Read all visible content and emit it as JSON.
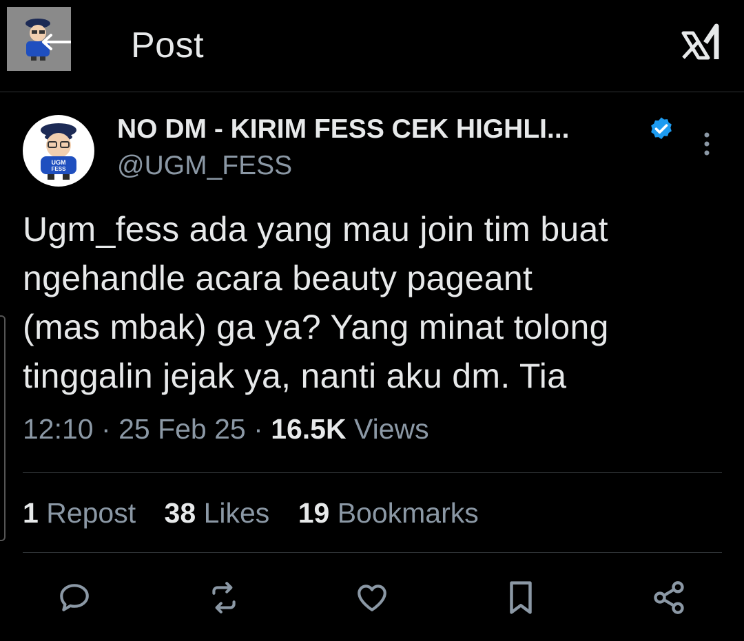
{
  "header": {
    "title": "Post",
    "back_icon": "arrow-left-icon",
    "grok_icon": "grok-icon"
  },
  "author": {
    "name": "NO DM - KIRIM FESS CEK HIGHLI...",
    "handle": "@UGM_FESS",
    "verified": true,
    "avatar_text": "UGM FESS"
  },
  "tweet": {
    "lines": [
      "Ugm_fess ada yang mau join tim buat",
      "ngehandle acara beauty pageant",
      "(mas mbak) ga ya? Yang minat tolong",
      "tinggalin jejak ya, nanti aku dm. Tia"
    ]
  },
  "meta": {
    "time": "12:10",
    "sep1": "·",
    "date": "25 Feb 25",
    "sep2": "·",
    "views_count": "16.5K",
    "views_label": "Views"
  },
  "stats": {
    "reposts_count": "1",
    "reposts_label": "Repost",
    "likes_count": "38",
    "likes_label": "Likes",
    "bookmarks_count": "19",
    "bookmarks_label": "Bookmarks"
  },
  "actions": [
    "reply-icon",
    "repost-icon",
    "like-icon",
    "bookmark-icon",
    "share-icon"
  ],
  "colors": {
    "background": "#000000",
    "text": "#e7e9ea",
    "secondary": "#8b98a5",
    "verified": "#1d9bf0",
    "divider": "#2f3336"
  }
}
